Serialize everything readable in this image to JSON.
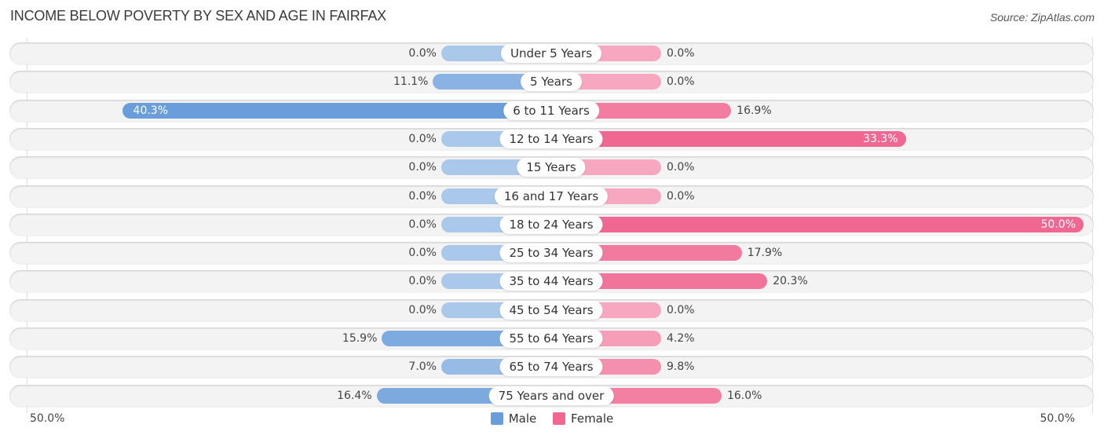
{
  "title": "INCOME BELOW POVERTY BY SEX AND AGE IN FAIRFAX",
  "source": "Source: ZipAtlas.com",
  "colors": {
    "male_strong": "#6a9edb",
    "male_light": "#a9c8ea",
    "female_strong": "#f06892",
    "female_light": "#f7a8c0",
    "row_bg": "#f3f3f3"
  },
  "chart_data": {
    "type": "bar",
    "orientation": "horizontal-diverging",
    "title": "INCOME BELOW POVERTY BY SEX AND AGE IN FAIRFAX",
    "xlabel": "",
    "ylabel": "",
    "xlim": [
      -50,
      50
    ],
    "axis_labels": {
      "left": "50.0%",
      "right": "50.0%"
    },
    "legend": {
      "position": "bottom-center",
      "entries": [
        "Male",
        "Female"
      ]
    },
    "categories": [
      "Under 5 Years",
      "5 Years",
      "6 to 11 Years",
      "12 to 14 Years",
      "15 Years",
      "16 and 17 Years",
      "18 to 24 Years",
      "25 to 34 Years",
      "35 to 44 Years",
      "45 to 54 Years",
      "55 to 64 Years",
      "65 to 74 Years",
      "75 Years and over"
    ],
    "series": [
      {
        "name": "Male",
        "values": [
          0.0,
          11.1,
          40.3,
          0.0,
          0.0,
          0.0,
          0.0,
          0.0,
          0.0,
          0.0,
          15.9,
          7.0,
          16.4
        ],
        "labels": [
          "0.0%",
          "11.1%",
          "40.3%",
          "0.0%",
          "0.0%",
          "0.0%",
          "0.0%",
          "0.0%",
          "0.0%",
          "0.0%",
          "15.9%",
          "7.0%",
          "16.4%"
        ]
      },
      {
        "name": "Female",
        "values": [
          0.0,
          0.0,
          16.9,
          33.3,
          0.0,
          0.0,
          50.0,
          17.9,
          20.3,
          0.0,
          4.2,
          9.8,
          16.0
        ],
        "labels": [
          "0.0%",
          "0.0%",
          "16.9%",
          "33.3%",
          "0.0%",
          "0.0%",
          "50.0%",
          "17.9%",
          "20.3%",
          "0.0%",
          "4.2%",
          "9.8%",
          "16.0%"
        ]
      }
    ]
  }
}
